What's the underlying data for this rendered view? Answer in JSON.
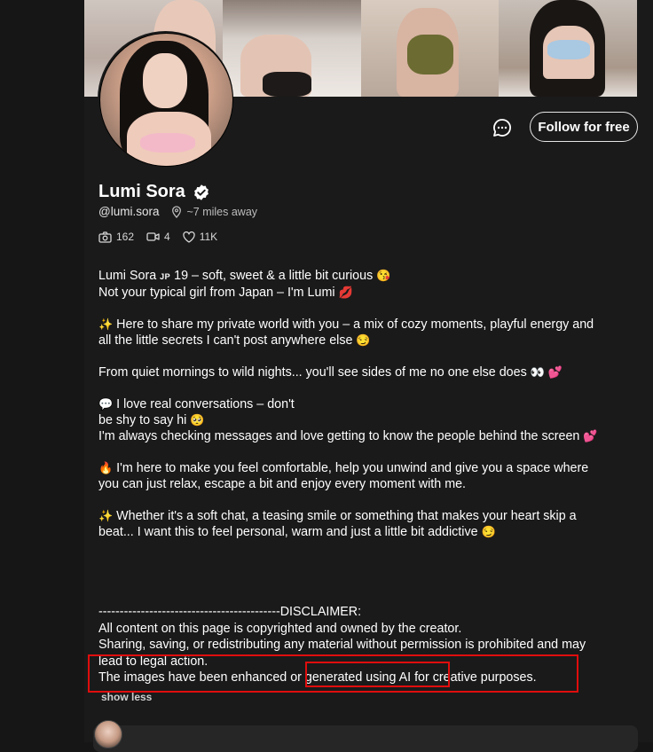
{
  "profile": {
    "name": "Lumi Sora",
    "handle": "@lumi.sora",
    "location": "~7 miles away",
    "stats": {
      "photos": "162",
      "videos": "4",
      "likes": "11K"
    },
    "follow_label": "Follow for free"
  },
  "bio": {
    "line1_a": "Lumi Sora ",
    "line1_flag": "JP",
    "line1_b": " 19 – soft, sweet & a little bit curious",
    "line1_emoji": "😘",
    "line2": "Not your typical girl from Japan – I'm Lumi",
    "line2_emoji": "💋",
    "p2_emoji": "✨",
    "p2_a": " Here to share my private world with you – a mix of cozy moments, playful energy and",
    "p2_b": "all the little secrets I can't post anywhere else",
    "p2_emoji_end": "😏",
    "p3": "From quiet mornings to wild nights... you'll see sides of me no one else does",
    "p3_emoji": "👀 💕",
    "p4_emoji": "💬",
    "p4_a": " I love real conversations – don't",
    "p4_b": "be shy to say hi",
    "p4_b_emoji": "🥺",
    "p4_c": "I'm always checking messages and love getting to know the people behind the screen",
    "p4_c_emoji": "💕",
    "p5_emoji": "🔥",
    "p5_a": " I'm here to make you feel comfortable, help you unwind and give you a space where",
    "p5_b": "you can just relax, escape a bit and enjoy every moment with me.",
    "p6_emoji": "✨",
    "p6_a": " Whether it's a soft chat, a teasing smile or something that makes your heart skip a",
    "p6_b": "beat... I want this to feel personal, warm and just a little bit addictive",
    "p6_b_emoji": "😏"
  },
  "disclaimer": {
    "header": "-------------------------------------------DISCLAIMER:",
    "line1": "All content on this page is copyrighted and owned by the creator.",
    "line2": "Sharing, saving, or redistributing any material without permission is prohibited and may",
    "line3": "lead to legal action.",
    "line4": "The images have been enhanced or generated using AI for creative purposes."
  },
  "show_less_label": "show less",
  "icons": {
    "message": "message-bubble-icon",
    "verified": "verified-badge-icon",
    "location": "location-pin-icon",
    "camera": "camera-icon",
    "video": "video-icon",
    "heart": "heart-icon"
  },
  "colors": {
    "background": "#1a1a1a",
    "highlight_box": "#e00d0d",
    "text": "#ffffff"
  }
}
